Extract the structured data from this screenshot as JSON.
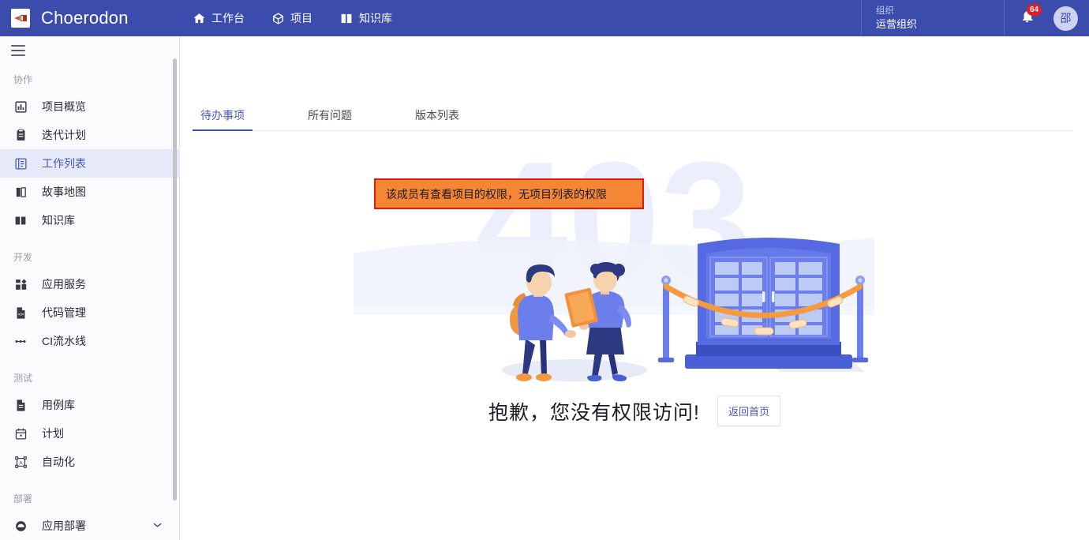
{
  "header": {
    "brand": "Choerodon",
    "logo_icon": "choerodon-logo-icon",
    "nav": [
      {
        "label": "工作台",
        "icon": "home-icon"
      },
      {
        "label": "项目",
        "icon": "cube-icon"
      },
      {
        "label": "知识库",
        "icon": "book-icon"
      }
    ],
    "org": {
      "label": "组织",
      "value": "运营组织"
    },
    "notification": {
      "icon": "bell-icon",
      "badge": "64"
    },
    "avatar": {
      "text": "邵"
    }
  },
  "sidebar": {
    "menu_icon": "hamburger-icon",
    "groups": [
      {
        "title": "协作",
        "items": [
          {
            "label": "项目概览",
            "icon": "chart-bar-icon",
            "active": false
          },
          {
            "label": "迭代计划",
            "icon": "clipboard-icon",
            "active": false
          },
          {
            "label": "工作列表",
            "icon": "list-document-icon",
            "active": true
          },
          {
            "label": "故事地图",
            "icon": "map-icon",
            "active": false
          },
          {
            "label": "知识库",
            "icon": "book-open-icon",
            "active": false
          }
        ]
      },
      {
        "title": "开发",
        "items": [
          {
            "label": "应用服务",
            "icon": "grid-apps-icon",
            "active": false
          },
          {
            "label": "代码管理",
            "icon": "code-file-icon",
            "active": false
          },
          {
            "label": "CI流水线",
            "icon": "dots-pipeline-icon",
            "active": false
          }
        ]
      },
      {
        "title": "测试",
        "items": [
          {
            "label": "用例库",
            "icon": "file-text-icon",
            "active": false
          },
          {
            "label": "计划",
            "icon": "calendar-icon",
            "active": false
          },
          {
            "label": "自动化",
            "icon": "automation-frame-icon",
            "active": false
          }
        ]
      },
      {
        "title": "部署",
        "items": [
          {
            "label": "应用部署",
            "icon": "cloud-deploy-icon",
            "active": false,
            "chevron": "chevron-down-icon"
          }
        ]
      }
    ]
  },
  "main": {
    "tabs": [
      {
        "label": "待办事项",
        "active": true
      },
      {
        "label": "所有问题",
        "active": false
      },
      {
        "label": "版本列表",
        "active": false
      }
    ],
    "callout": {
      "text": "该成员有查看项目的权限，无项目列表的权限"
    },
    "error": {
      "code": "403",
      "message": "抱歉，您没有权限访问!",
      "button": "返回首页",
      "illustration": "403-locked-door-illustration"
    }
  },
  "colors": {
    "header_blue": "#3b4cad",
    "accent_blue": "#4758c1",
    "active_bg": "#e6e9f8",
    "badge_red": "#e81b23",
    "callout_bg": "#f58634",
    "callout_border": "#e01b0c",
    "illu_light": "#dfe6fb",
    "illu_blue": "#5569e0",
    "illu_navy": "#2d3a8c",
    "illu_orange": "#f59a3e"
  }
}
